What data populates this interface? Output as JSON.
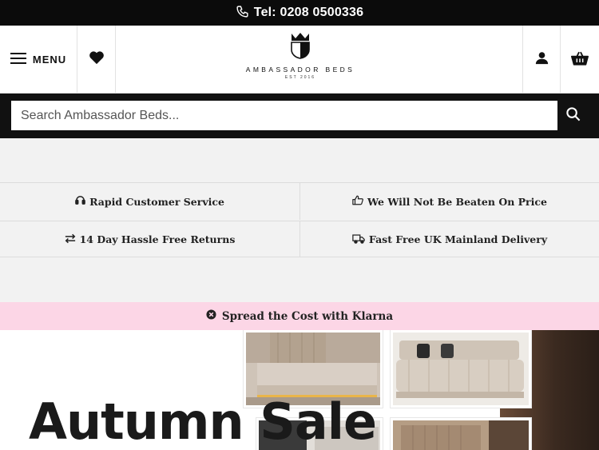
{
  "topbar": {
    "phone_text": "Tel: 0208 0500336",
    "icon": "phone-icon"
  },
  "header": {
    "menu_label": "MENU",
    "logo_name": "AMBASSADOR BEDS",
    "logo_est": "EST 2016",
    "icons": [
      "hamburger-icon",
      "heart-icon",
      "crown-shield-icon",
      "user-icon",
      "basket-icon"
    ]
  },
  "search": {
    "placeholder": "Search Ambassador Beds...",
    "icon": "search-icon"
  },
  "usps": [
    {
      "label": "Rapid Customer Service",
      "icon": "headset-icon"
    },
    {
      "label": "We Will Not Be Beaten On Price",
      "icon": "thumbs-up-icon"
    },
    {
      "label": "14 Day Hassle Free Returns",
      "icon": "exchange-icon"
    },
    {
      "label": "Fast Free UK Mainland Delivery",
      "icon": "truck-icon"
    }
  ],
  "klarna": {
    "label": "Spread the Cost with Klarna",
    "icon": "klarna-badge-icon"
  },
  "hero": {
    "title": "Autumn Sale"
  },
  "colors": {
    "topbar": "#0b0b0b",
    "search_bar": "#111111",
    "usp_background": "#f2f2f2",
    "klarna_background": "#fcd6e6"
  }
}
